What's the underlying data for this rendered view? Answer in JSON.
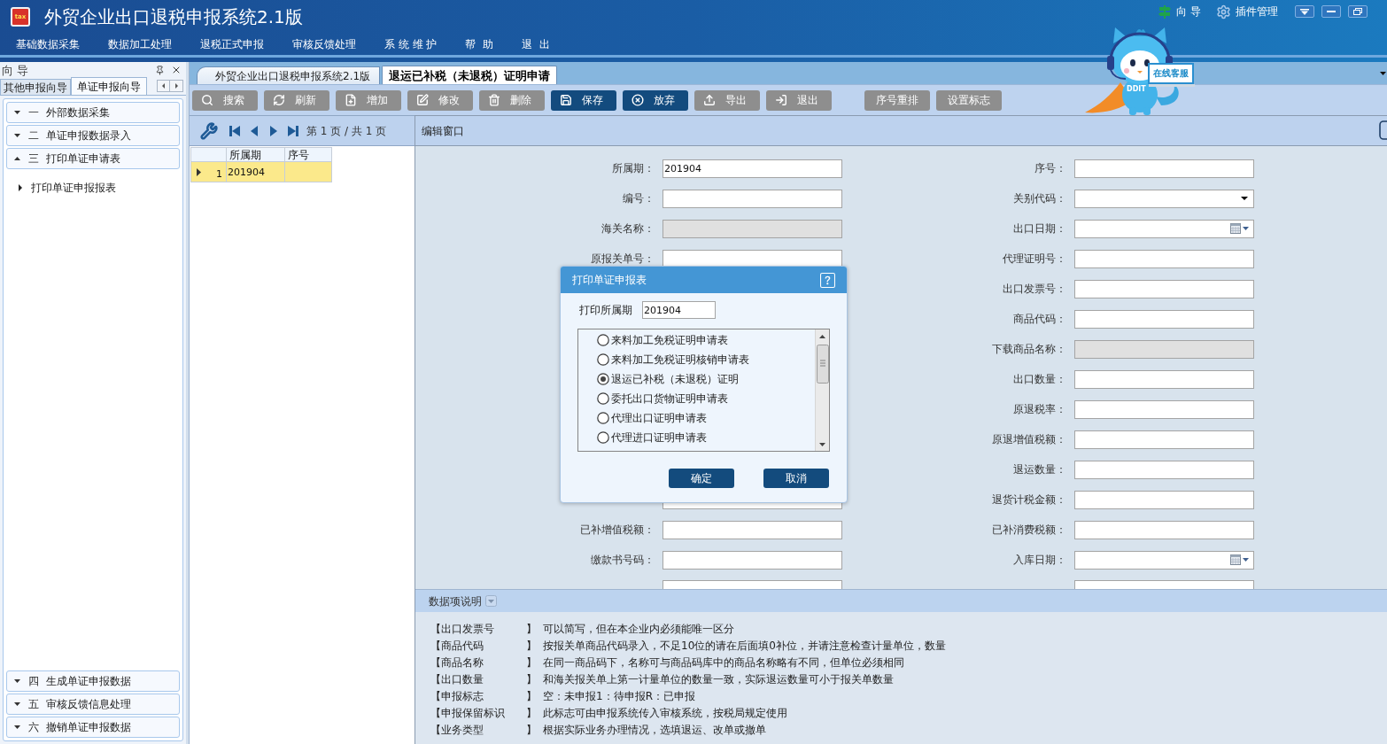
{
  "window": {
    "title": "外贸企业出口退税申报系统2.1版",
    "logo_text": "tax"
  },
  "header_links": [
    {
      "label": "向 导"
    },
    {
      "label": "插件管理"
    }
  ],
  "menu": [
    "基础数据采集",
    "数据加工处理",
    "退税正式申报",
    "审核反馈处理",
    "系 统 维 护",
    "帮  助",
    "退  出"
  ],
  "mascot": {
    "sign": "在线客服",
    "badge": "DDIT"
  },
  "guide_panel": {
    "title": "向 导",
    "tabs": [
      {
        "label": "其他申报向导",
        "selected": false
      },
      {
        "label": "单证申报向导",
        "selected": true
      }
    ],
    "sections": [
      {
        "label": "一  外部数据采集",
        "expanded": false
      },
      {
        "label": "二  单证申报数据录入",
        "expanded": false
      },
      {
        "label": "三  打印单证申请表",
        "expanded": true,
        "children": [
          {
            "label": "打印单证申报报表"
          }
        ]
      },
      {
        "label": "四  生成单证申报数据",
        "expanded": false
      },
      {
        "label": "五  审核反馈信息处理",
        "expanded": false
      },
      {
        "label": "六  撤销单证申报数据",
        "expanded": false
      }
    ]
  },
  "document_tabs": [
    {
      "label": "外贸企业出口退税申报系统2.1版",
      "selected": false
    },
    {
      "label": "退运已补税（未退税）证明申请",
      "selected": true
    }
  ],
  "toolbar": {
    "groups": [
      [
        {
          "label": "搜索",
          "color": "#8e8e8e"
        },
        {
          "label": "刷新",
          "color": "#8e8e8e"
        },
        {
          "label": "增加",
          "color": "#8e8e8e"
        },
        {
          "label": "修改",
          "color": "#8e8e8e"
        },
        {
          "label": "删除",
          "color": "#8e8e8e"
        },
        {
          "label": "保存",
          "color": "#134b7e"
        },
        {
          "label": "放弃",
          "color": "#134b7e"
        },
        {
          "label": "导出",
          "color": "#8e8e8e"
        },
        {
          "label": "退出",
          "color": "#8e8e8e"
        }
      ],
      [
        {
          "label": "序号重排",
          "color": "#8e8e8e"
        },
        {
          "label": "设置标志",
          "color": "#8e8e8e"
        }
      ]
    ]
  },
  "pager": {
    "text": "第 1 页 / 共 1 页"
  },
  "grid": {
    "columns": [
      "所属期",
      "序号"
    ],
    "rows": [
      {
        "number": "1",
        "cells": [
          "201904"
        ],
        "selected": true
      }
    ]
  },
  "editor": {
    "title": "编辑窗口",
    "left_upper": [
      {
        "label": "所属期：",
        "kind": "text",
        "value": "201904",
        "disabled": false
      },
      {
        "label": "编号：",
        "kind": "text",
        "disabled": false
      },
      {
        "label": "海关名称：",
        "kind": "text",
        "disabled": true
      },
      {
        "label": "原报关单号：",
        "kind": "text",
        "disabled": false
      }
    ],
    "left_lower": [
      {
        "kind": "covered",
        "disabled": false
      },
      {
        "label": "已补增值税额：",
        "kind": "text",
        "disabled": false
      },
      {
        "label": "缴款书号码：",
        "kind": "text",
        "disabled": false
      },
      {
        "kind": "cut",
        "disabled": false
      }
    ],
    "right": [
      {
        "label": "序号：",
        "kind": "text",
        "disabled": false
      },
      {
        "label": "关别代码：",
        "kind": "select",
        "disabled": false
      },
      {
        "label": "出口日期：",
        "kind": "date",
        "disabled": false
      },
      {
        "label": "代理证明号：",
        "kind": "text",
        "disabled": false
      },
      {
        "label": "出口发票号：",
        "kind": "text",
        "disabled": false
      },
      {
        "label": "商品代码：",
        "kind": "text",
        "disabled": false
      },
      {
        "label": "下载商品名称：",
        "kind": "text",
        "disabled": true
      },
      {
        "label": "出口数量：",
        "kind": "text",
        "disabled": false
      },
      {
        "label": "原退税率：",
        "kind": "text",
        "disabled": false
      },
      {
        "label": "原退增值税额：",
        "kind": "text",
        "disabled": false
      },
      {
        "label": "退运数量：",
        "kind": "text",
        "disabled": false
      },
      {
        "label": "退货计税金额：",
        "kind": "text",
        "disabled": false
      },
      {
        "label": "已补消费税额：",
        "kind": "text",
        "disabled": false
      },
      {
        "label": "入库日期：",
        "kind": "date",
        "disabled": false
      },
      {
        "kind": "cut",
        "disabled": false
      }
    ]
  },
  "dialog": {
    "title": "打印单证申报表",
    "period_label": "打印所属期",
    "period_value": "201904",
    "options": [
      {
        "label": "来料加工免税证明申请表",
        "selected": false
      },
      {
        "label": "来料加工免税证明核销申请表",
        "selected": false
      },
      {
        "label": "退运已补税（未退税）证明",
        "selected": true
      },
      {
        "label": "委托出口货物证明申请表",
        "selected": false
      },
      {
        "label": "代理出口证明申请表",
        "selected": false
      },
      {
        "label": "代理进口证明申请表",
        "selected": false
      }
    ],
    "buttons": [
      "确定",
      "取消"
    ]
  },
  "help_panel": {
    "title": "数据项说明",
    "rows": [
      {
        "term": "【出口发票号",
        "bracket": "】",
        "text": "可以简写，但在本企业内必须能唯一区分"
      },
      {
        "term": "【商品代码",
        "bracket": "】",
        "text": "按报关单商品代码录入，不足10位的请在后面填0补位，并请注意检查计量单位，数量"
      },
      {
        "term": "【商品名称",
        "bracket": "】",
        "text": "在同一商品码下，名称可与商品码库中的商品名称略有不同，但单位必须相同"
      },
      {
        "term": "【出口数量",
        "bracket": "】",
        "text": "和海关报关单上第一计量单位的数量一致，实际退运数量可小于报关单数量"
      },
      {
        "term": "【申报标志",
        "bracket": "】",
        "text": "空：未申报1：待申报R：已申报"
      },
      {
        "term": "【申报保留标识",
        "bracket": "】",
        "text": "此标志可由申报系统传入审核系统，按税局规定使用"
      },
      {
        "term": "【业务类型",
        "bracket": "】",
        "text": "根据实际业务办理情况，选填退运、改单或撤单"
      }
    ]
  }
}
